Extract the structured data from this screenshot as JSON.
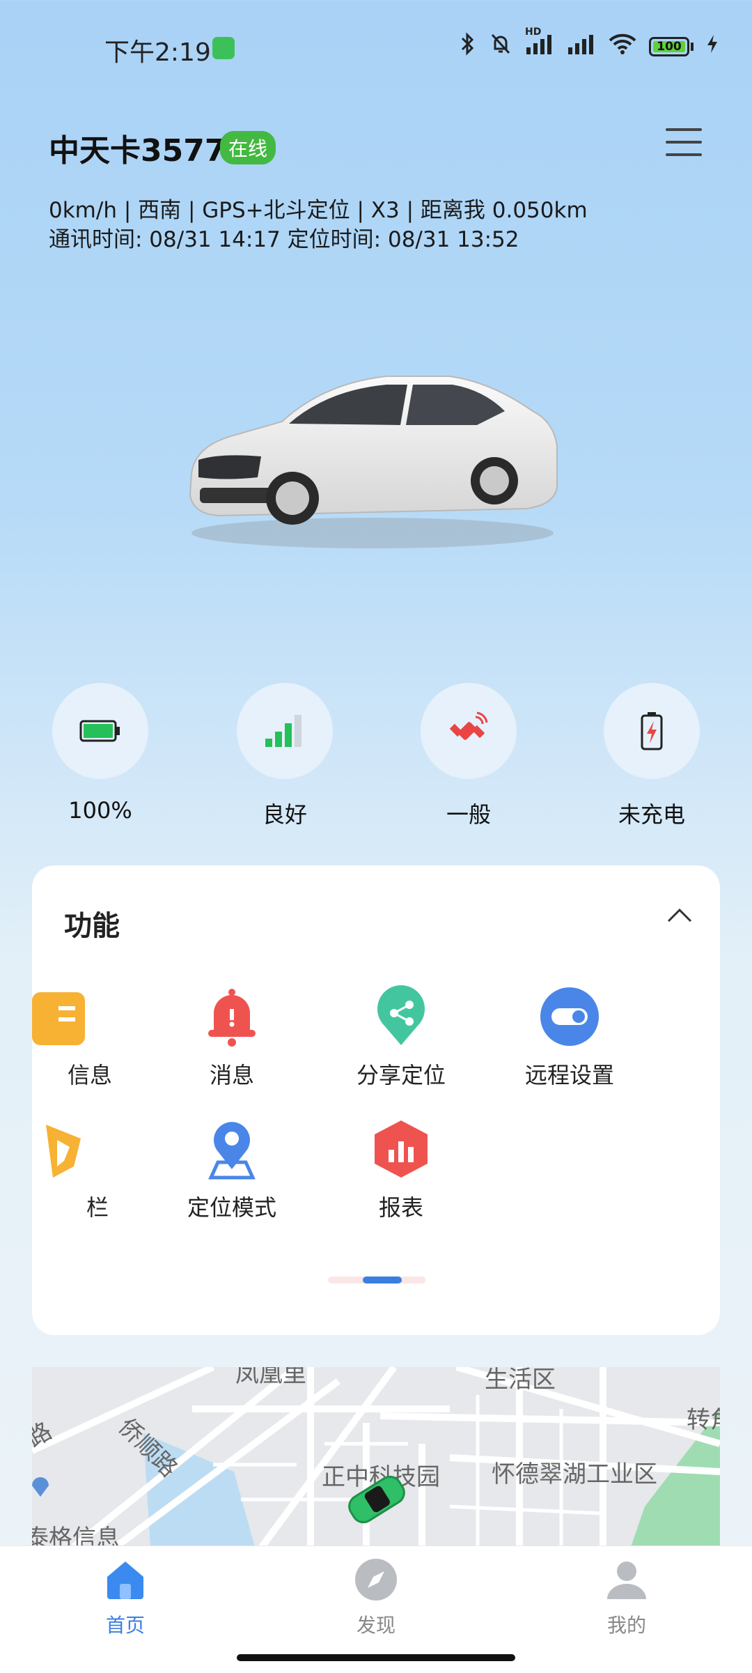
{
  "status_bar": {
    "time": "下午2:19",
    "signal_label": "HD",
    "battery_level": "100"
  },
  "header": {
    "device_name": "中天卡3577",
    "online_status": "在线",
    "info_line1": "0km/h | 西南 | GPS+北斗定位 | X3 | 距离我 0.050km",
    "info_line2": "通讯时间: 08/31 14:17    定位时间: 08/31 13:52"
  },
  "indicators": [
    {
      "icon": "battery-icon",
      "label": "100%"
    },
    {
      "icon": "signal-bars-icon",
      "label": "良好"
    },
    {
      "icon": "satellite-icon",
      "label": "一般"
    },
    {
      "icon": "charging-icon",
      "label": "未充电"
    }
  ],
  "functions": {
    "title": "功能",
    "items": [
      {
        "icon": "info-icon",
        "label": "信息"
      },
      {
        "icon": "bell-icon",
        "label": "消息"
      },
      {
        "icon": "share-location-icon",
        "label": "分享定位"
      },
      {
        "icon": "toggle-icon",
        "label": "远程设置"
      },
      {
        "icon": "fence-icon",
        "label": "栏"
      },
      {
        "icon": "location-pin-icon",
        "label": "定位模式"
      },
      {
        "icon": "report-icon",
        "label": "报表"
      }
    ]
  },
  "map": {
    "labels": [
      "凤凰里",
      "生活区",
      "侨顺路",
      "路",
      "转角",
      "正中科技园",
      "怀德翠湖工业区",
      "泰格信息"
    ]
  },
  "nav": {
    "items": [
      {
        "icon": "home-icon",
        "label": "首页",
        "active": true
      },
      {
        "icon": "compass-icon",
        "label": "发现",
        "active": false
      },
      {
        "icon": "user-icon",
        "label": "我的",
        "active": false
      }
    ]
  },
  "colors": {
    "accent": "#3a7fe0",
    "online": "#43b941",
    "background_top": "#a9d2f6"
  }
}
